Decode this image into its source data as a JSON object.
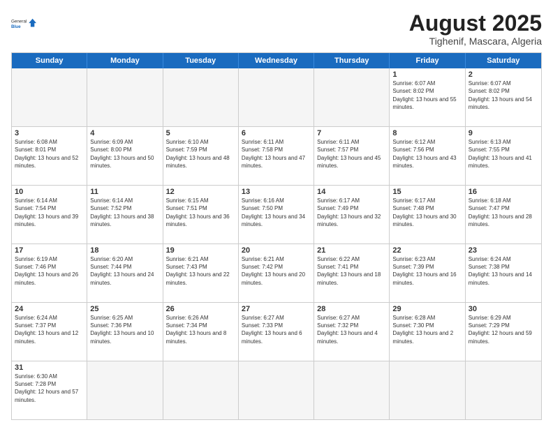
{
  "header": {
    "logo_general": "General",
    "logo_blue": "Blue",
    "month_year": "August 2025",
    "location": "Tighenif, Mascara, Algeria"
  },
  "weekdays": [
    "Sunday",
    "Monday",
    "Tuesday",
    "Wednesday",
    "Thursday",
    "Friday",
    "Saturday"
  ],
  "rows": [
    [
      {
        "day": "",
        "empty": true
      },
      {
        "day": "",
        "empty": true
      },
      {
        "day": "",
        "empty": true
      },
      {
        "day": "",
        "empty": true
      },
      {
        "day": "",
        "empty": true
      },
      {
        "day": "1",
        "sunrise": "6:07 AM",
        "sunset": "8:02 PM",
        "daylight": "13 hours and 55 minutes."
      },
      {
        "day": "2",
        "sunrise": "6:07 AM",
        "sunset": "8:02 PM",
        "daylight": "13 hours and 54 minutes."
      }
    ],
    [
      {
        "day": "3",
        "sunrise": "6:08 AM",
        "sunset": "8:01 PM",
        "daylight": "13 hours and 52 minutes."
      },
      {
        "day": "4",
        "sunrise": "6:09 AM",
        "sunset": "8:00 PM",
        "daylight": "13 hours and 50 minutes."
      },
      {
        "day": "5",
        "sunrise": "6:10 AM",
        "sunset": "7:59 PM",
        "daylight": "13 hours and 48 minutes."
      },
      {
        "day": "6",
        "sunrise": "6:11 AM",
        "sunset": "7:58 PM",
        "daylight": "13 hours and 47 minutes."
      },
      {
        "day": "7",
        "sunrise": "6:11 AM",
        "sunset": "7:57 PM",
        "daylight": "13 hours and 45 minutes."
      },
      {
        "day": "8",
        "sunrise": "6:12 AM",
        "sunset": "7:56 PM",
        "daylight": "13 hours and 43 minutes."
      },
      {
        "day": "9",
        "sunrise": "6:13 AM",
        "sunset": "7:55 PM",
        "daylight": "13 hours and 41 minutes."
      }
    ],
    [
      {
        "day": "10",
        "sunrise": "6:14 AM",
        "sunset": "7:54 PM",
        "daylight": "13 hours and 39 minutes."
      },
      {
        "day": "11",
        "sunrise": "6:14 AM",
        "sunset": "7:52 PM",
        "daylight": "13 hours and 38 minutes."
      },
      {
        "day": "12",
        "sunrise": "6:15 AM",
        "sunset": "7:51 PM",
        "daylight": "13 hours and 36 minutes."
      },
      {
        "day": "13",
        "sunrise": "6:16 AM",
        "sunset": "7:50 PM",
        "daylight": "13 hours and 34 minutes."
      },
      {
        "day": "14",
        "sunrise": "6:17 AM",
        "sunset": "7:49 PM",
        "daylight": "13 hours and 32 minutes."
      },
      {
        "day": "15",
        "sunrise": "6:17 AM",
        "sunset": "7:48 PM",
        "daylight": "13 hours and 30 minutes."
      },
      {
        "day": "16",
        "sunrise": "6:18 AM",
        "sunset": "7:47 PM",
        "daylight": "13 hours and 28 minutes."
      }
    ],
    [
      {
        "day": "17",
        "sunrise": "6:19 AM",
        "sunset": "7:46 PM",
        "daylight": "13 hours and 26 minutes."
      },
      {
        "day": "18",
        "sunrise": "6:20 AM",
        "sunset": "7:44 PM",
        "daylight": "13 hours and 24 minutes."
      },
      {
        "day": "19",
        "sunrise": "6:21 AM",
        "sunset": "7:43 PM",
        "daylight": "13 hours and 22 minutes."
      },
      {
        "day": "20",
        "sunrise": "6:21 AM",
        "sunset": "7:42 PM",
        "daylight": "13 hours and 20 minutes."
      },
      {
        "day": "21",
        "sunrise": "6:22 AM",
        "sunset": "7:41 PM",
        "daylight": "13 hours and 18 minutes."
      },
      {
        "day": "22",
        "sunrise": "6:23 AM",
        "sunset": "7:39 PM",
        "daylight": "13 hours and 16 minutes."
      },
      {
        "day": "23",
        "sunrise": "6:24 AM",
        "sunset": "7:38 PM",
        "daylight": "13 hours and 14 minutes."
      }
    ],
    [
      {
        "day": "24",
        "sunrise": "6:24 AM",
        "sunset": "7:37 PM",
        "daylight": "13 hours and 12 minutes."
      },
      {
        "day": "25",
        "sunrise": "6:25 AM",
        "sunset": "7:36 PM",
        "daylight": "13 hours and 10 minutes."
      },
      {
        "day": "26",
        "sunrise": "6:26 AM",
        "sunset": "7:34 PM",
        "daylight": "13 hours and 8 minutes."
      },
      {
        "day": "27",
        "sunrise": "6:27 AM",
        "sunset": "7:33 PM",
        "daylight": "13 hours and 6 minutes."
      },
      {
        "day": "28",
        "sunrise": "6:27 AM",
        "sunset": "7:32 PM",
        "daylight": "13 hours and 4 minutes."
      },
      {
        "day": "29",
        "sunrise": "6:28 AM",
        "sunset": "7:30 PM",
        "daylight": "13 hours and 2 minutes."
      },
      {
        "day": "30",
        "sunrise": "6:29 AM",
        "sunset": "7:29 PM",
        "daylight": "12 hours and 59 minutes."
      }
    ],
    [
      {
        "day": "31",
        "sunrise": "6:30 AM",
        "sunset": "7:28 PM",
        "daylight": "12 hours and 57 minutes."
      },
      {
        "day": "",
        "empty": true
      },
      {
        "day": "",
        "empty": true
      },
      {
        "day": "",
        "empty": true
      },
      {
        "day": "",
        "empty": true
      },
      {
        "day": "",
        "empty": true
      },
      {
        "day": "",
        "empty": true
      }
    ]
  ]
}
